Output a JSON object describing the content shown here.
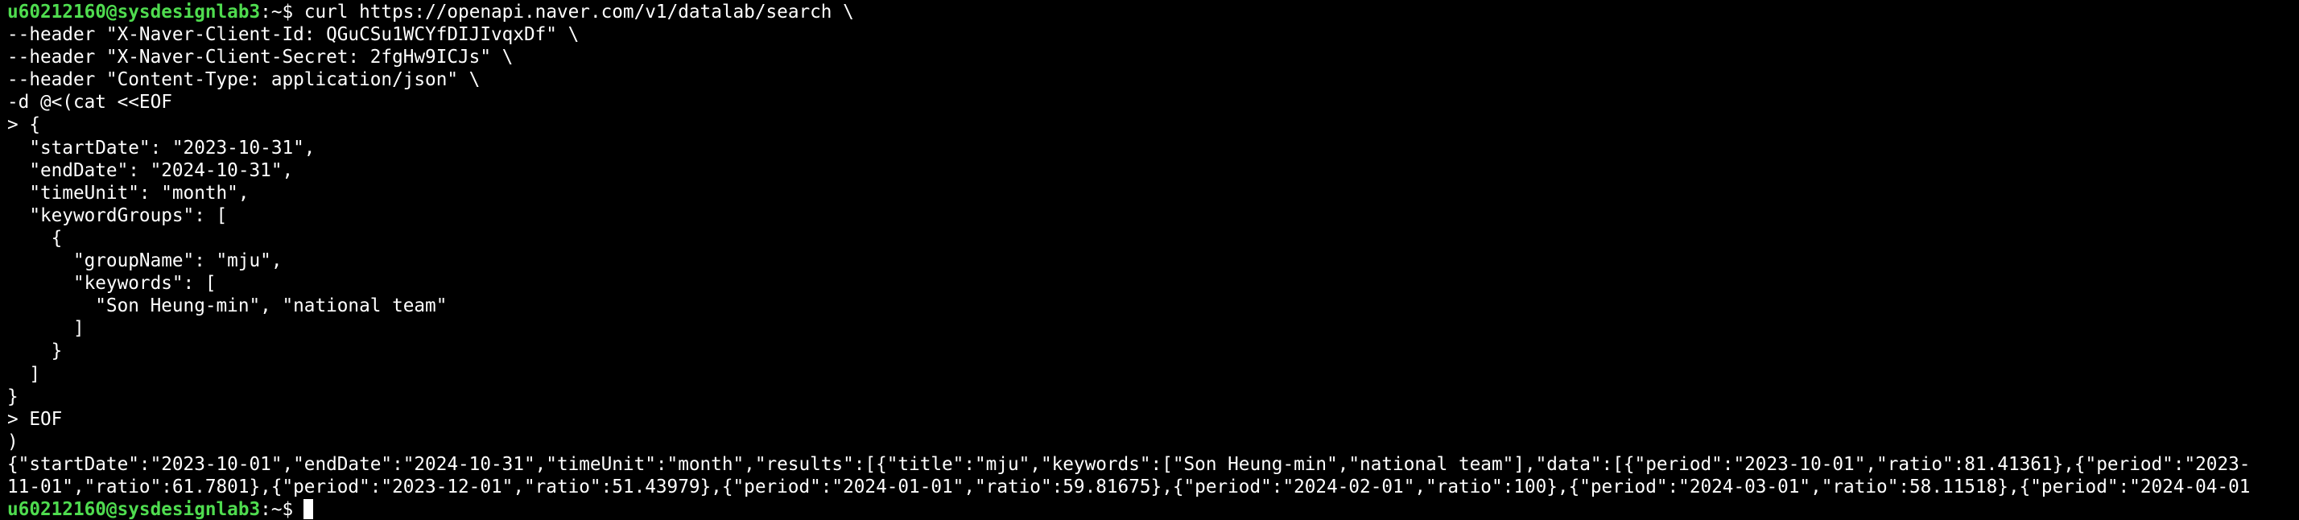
{
  "colors": {
    "background": "#000000",
    "text": "#ffffff",
    "prompt_user": "#4fdc4f"
  },
  "terminal": {
    "prompt": {
      "user_host": "u60212160@sysdesignlab3",
      "suffix": ":~$"
    },
    "command_first_line": " curl https://openapi.naver.com/v1/datalab/search \\",
    "input_lines": [
      "--header \"X-Naver-Client-Id: QGuCSu1WCYfDIJIvqxDf\" \\",
      "--header \"X-Naver-Client-Secret: 2fgHw9ICJs\" \\",
      "--header \"Content-Type: application/json\" \\",
      "-d @<(cat <<EOF",
      "> {",
      "  \"startDate\": \"2023-10-31\",",
      "  \"endDate\": \"2024-10-31\",",
      "  \"timeUnit\": \"month\",",
      "  \"keywordGroups\": [",
      "    {",
      "      \"groupName\": \"mju\",",
      "      \"keywords\": [",
      "        \"Son Heung-min\", \"national team\"",
      "      ]",
      "    }",
      "  ]",
      "}",
      "> EOF",
      ")"
    ],
    "output_lines": [
      "{\"startDate\":\"2023-10-01\",\"endDate\":\"2024-10-31\",\"timeUnit\":\"month\",\"results\":[{\"title\":\"mju\",\"keywords\":[\"Son Heung-min\",\"national team\"],\"data\":[{\"period\":\"2023-10-01\",\"ratio\":81.41361},{\"period\":\"2023-",
      "11-01\",\"ratio\":61.7801},{\"period\":\"2023-12-01\",\"ratio\":51.43979},{\"period\":\"2024-01-01\",\"ratio\":59.81675},{\"period\":\"2024-02-01\",\"ratio\":100},{\"period\":\"2024-03-01\",\"ratio\":58.11518},{\"period\":\"2024-04-01"
    ]
  }
}
